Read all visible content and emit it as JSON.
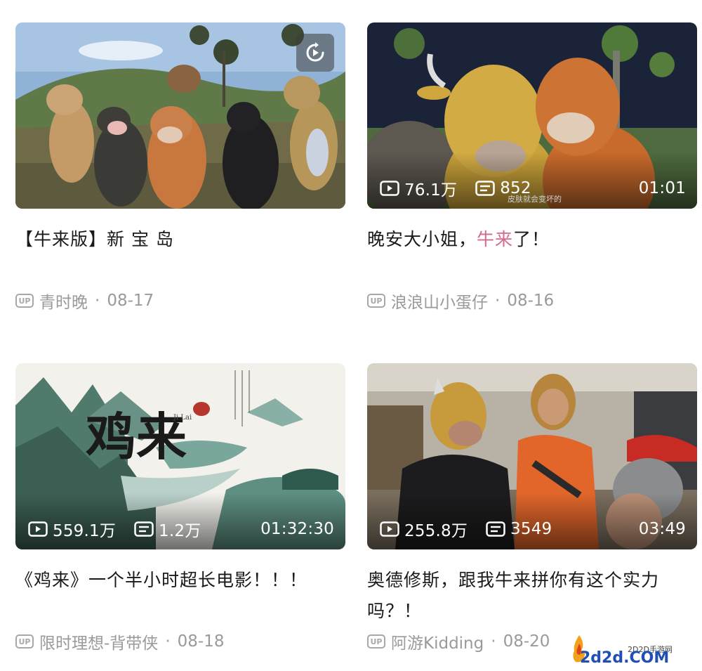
{
  "cards": [
    {
      "title": "【牛来版】新 宝 岛",
      "title_highlight": "",
      "title_suffix": "",
      "uploader": "青时晚",
      "date": "08-17",
      "overlay": "replay-icon"
    },
    {
      "title": "晚安大小姐，",
      "title_highlight": "牛来",
      "title_suffix": "了！",
      "uploader": "浪浪山小蛋仔",
      "date": "08-16",
      "views": "76.1万",
      "danmaku": "852",
      "duration": "01:01",
      "subtitle": "皮肤就会变坏的"
    },
    {
      "title": "《鸡来》一个半小时超长电影！！！",
      "title_highlight": "",
      "title_suffix": "",
      "uploader": "限时理想-背带侠",
      "date": "08-18",
      "views": "559.1万",
      "danmaku": "1.2万",
      "duration": "01:32:30",
      "art_text": "鸡来",
      "art_text_small": "Ji Lai"
    },
    {
      "title": "奥德修斯，跟我牛来拼你有这个实力吗？！",
      "title_highlight": "",
      "title_suffix": "",
      "uploader": "阿游Kidding",
      "date": "08-20",
      "views": "255.8万",
      "danmaku": "3549",
      "duration": "03:49"
    }
  ],
  "badge_label": "UP",
  "separator": "·",
  "watermark": {
    "site": "2D2D手游网",
    "domain": "2d2d.COM"
  },
  "colors": {
    "title": "#1a1a1a",
    "highlight": "#d46a8a",
    "meta": "#9a9a9a"
  }
}
